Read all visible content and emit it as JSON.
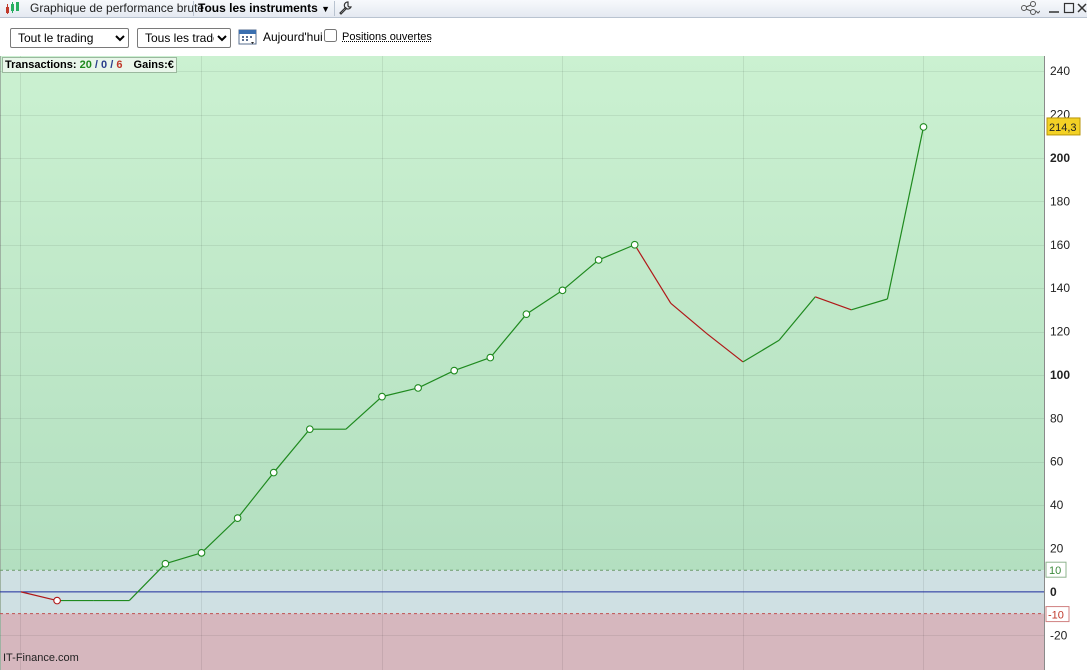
{
  "titlebar": {
    "window_title": "Graphique de performance brute",
    "instruments_label": "Tous les instruments"
  },
  "toolbar": {
    "scope_select": {
      "selected": "Tout le trading"
    },
    "trades_select": {
      "selected": "Tous les trades"
    },
    "today_label": "Aujourd'hui",
    "open_positions_label": "Positions ouvertes",
    "open_positions_checked": false
  },
  "summary": {
    "transactions_label": "Transactions:",
    "wins": "20",
    "neutral": "0",
    "losses": "6",
    "slash": "/",
    "gains_label": "Gains:",
    "gains_unit": "€"
  },
  "watermark": "IT-Finance.com",
  "chart_data": {
    "type": "line",
    "ylim": [
      -36,
      247
    ],
    "y_ticks": [
      -20,
      0,
      20,
      40,
      60,
      80,
      100,
      120,
      140,
      160,
      180,
      200,
      220,
      240
    ],
    "y_ticks_bold": [
      0,
      100,
      200
    ],
    "thresholds": {
      "upper": 10,
      "lower": -10,
      "upper_label": "10",
      "lower_label": "-10"
    },
    "last_value_label": "214,3",
    "series": [
      {
        "values": [
          0,
          -4,
          -4,
          -4,
          13,
          18,
          34,
          55,
          75,
          75,
          90,
          94,
          102,
          108,
          128,
          139,
          153,
          160,
          133,
          119,
          106,
          116,
          136,
          130,
          135,
          214.3
        ],
        "markers": [
          false,
          true,
          false,
          false,
          true,
          true,
          true,
          true,
          true,
          false,
          true,
          true,
          true,
          true,
          true,
          true,
          true,
          true,
          false,
          false,
          false,
          false,
          false,
          false,
          false,
          true
        ]
      }
    ],
    "colors": {
      "gain": "#1f8a1f",
      "loss": "#b01818",
      "zero": "#1b2a9a",
      "threshold_up": "#6b9a6b",
      "threshold_down": "#c05050",
      "tag_bg": "#f3d125"
    }
  }
}
